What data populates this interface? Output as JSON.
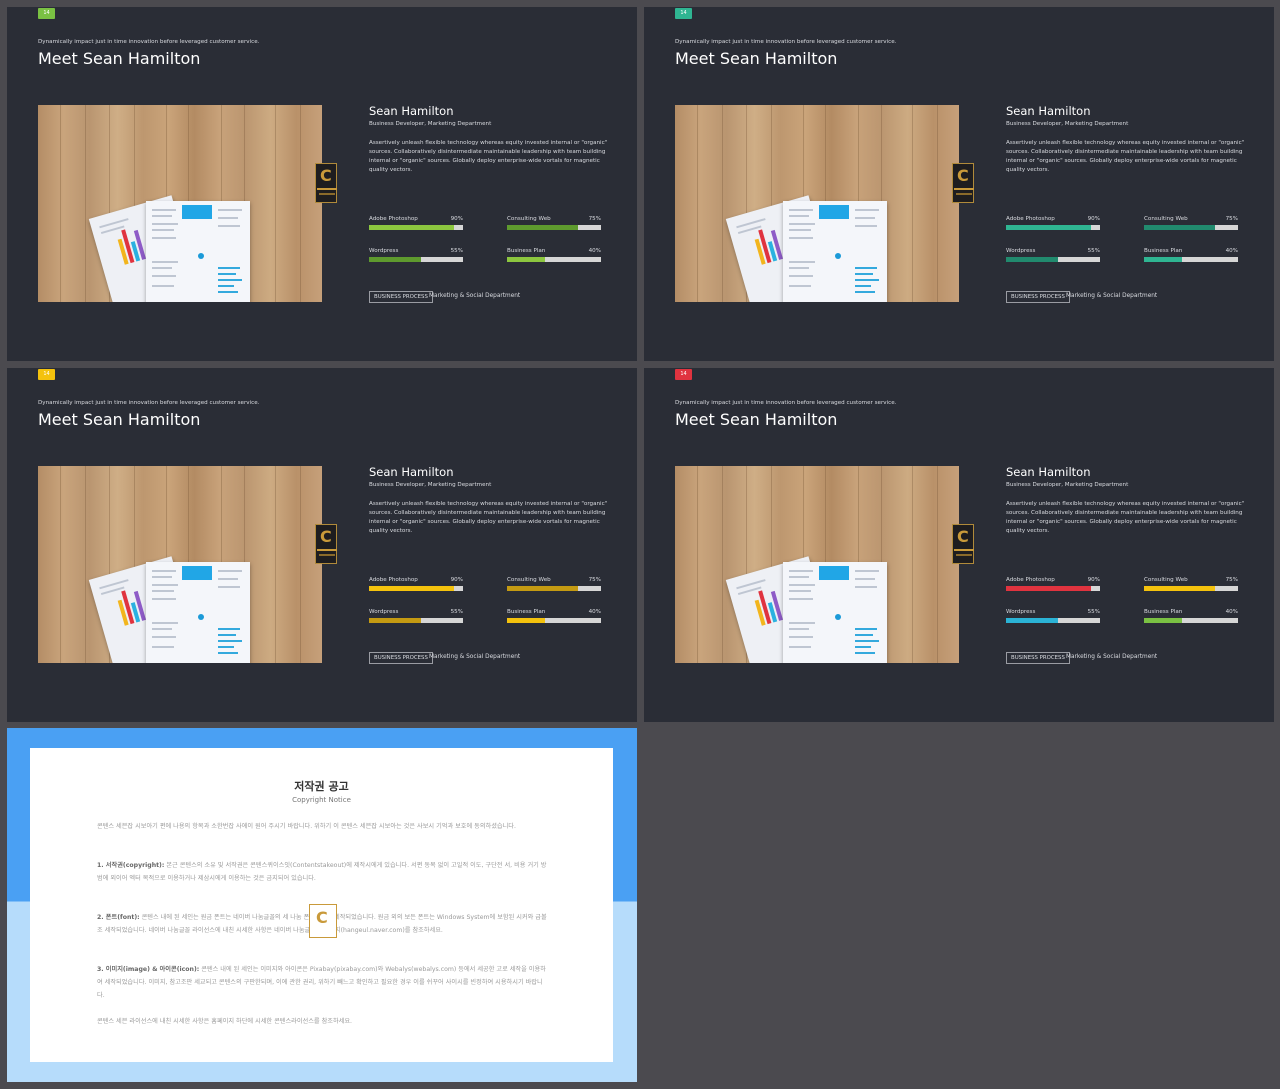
{
  "slides": [
    {
      "badge": "14",
      "badge_color": "#7ac143",
      "tagline": "Dynamically impact just in time innovation  before leveraged customer service.",
      "title": "Meet Sean Hamilton",
      "name": "Sean Hamilton",
      "role": "Business Developer, Marketing Department",
      "description": "Assertively unleash flexible technology whereas equity invested internal or \"organic\" sources. Collaboratively disintermediate maintainable leadership with team building internal or \"organic\" sources. Globally deploy enterprise-wide vortals for magnetic quality vectors.",
      "skills": [
        {
          "label": "Adobe Photoshop",
          "percent_label": "90%",
          "value": 90,
          "color": "#8cc63f"
        },
        {
          "label": "Consulting Web",
          "percent_label": "75%",
          "value": 75,
          "color": "#5e9a2e"
        },
        {
          "label": "Wordpress",
          "percent_label": "55%",
          "value": 55,
          "color": "#5e9a2e"
        },
        {
          "label": "Business Plan",
          "percent_label": "40%",
          "value": 40,
          "color": "#8cc63f"
        }
      ],
      "tag": "BUSINESS PROCESS",
      "department": "Marketing & Social Department"
    },
    {
      "badge": "14",
      "badge_color": "#2fb592",
      "tagline": "Dynamically impact just in time innovation  before leveraged customer service.",
      "title": "Meet Sean Hamilton",
      "name": "Sean Hamilton",
      "role": "Business Developer, Marketing Department",
      "description": "Assertively unleash flexible technology whereas equity invested internal or \"organic\" sources. Collaboratively disintermediate maintainable leadership with team building internal or \"organic\" sources. Globally deploy enterprise-wide vortals for magnetic quality vectors.",
      "skills": [
        {
          "label": "Adobe Photoshop",
          "percent_label": "90%",
          "value": 90,
          "color": "#2fb592"
        },
        {
          "label": "Consulting Web",
          "percent_label": "75%",
          "value": 75,
          "color": "#218a6e"
        },
        {
          "label": "Wordpress",
          "percent_label": "55%",
          "value": 55,
          "color": "#218a6e"
        },
        {
          "label": "Business Plan",
          "percent_label": "40%",
          "value": 40,
          "color": "#2fb592"
        }
      ],
      "tag": "BUSINESS PROCESS",
      "department": "Marketing & Social Department"
    },
    {
      "badge": "14",
      "badge_color": "#f4c20d",
      "tagline": "Dynamically impact just in time innovation  before leveraged customer service.",
      "title": "Meet Sean Hamilton",
      "name": "Sean Hamilton",
      "role": "Business Developer, Marketing Department",
      "description": "Assertively unleash flexible technology whereas equity invested internal or \"organic\" sources. Collaboratively disintermediate maintainable leadership with team building internal or \"organic\" sources. Globally deploy enterprise-wide vortals for magnetic quality vectors.",
      "skills": [
        {
          "label": "Adobe Photoshop",
          "percent_label": "90%",
          "value": 90,
          "color": "#f4c20d"
        },
        {
          "label": "Consulting Web",
          "percent_label": "75%",
          "value": 75,
          "color": "#c49a12"
        },
        {
          "label": "Wordpress",
          "percent_label": "55%",
          "value": 55,
          "color": "#c49a12"
        },
        {
          "label": "Business Plan",
          "percent_label": "40%",
          "value": 40,
          "color": "#f4c20d"
        }
      ],
      "tag": "BUSINESS PROCESS",
      "department": "Marketing & Social Department"
    },
    {
      "badge": "14",
      "badge_color": "#e0333f",
      "tagline": "Dynamically impact just in time innovation  before leveraged customer service.",
      "title": "Meet Sean Hamilton",
      "name": "Sean Hamilton",
      "role": "Business Developer, Marketing Department",
      "description": "Assertively unleash flexible technology whereas equity invested internal or \"organic\" sources. Collaboratively disintermediate maintainable leadership with team building internal or \"organic\" sources. Globally deploy enterprise-wide vortals for magnetic quality vectors.",
      "skills": [
        {
          "label": "Adobe Photoshop",
          "percent_label": "90%",
          "value": 90,
          "color": "#e0333f"
        },
        {
          "label": "Consulting Web",
          "percent_label": "75%",
          "value": 75,
          "color": "#f4c20d"
        },
        {
          "label": "Wordpress",
          "percent_label": "55%",
          "value": 55,
          "color": "#2bb3d6"
        },
        {
          "label": "Business Plan",
          "percent_label": "40%",
          "value": 40,
          "color": "#7ac143"
        }
      ],
      "tag": "BUSINESS PROCESS",
      "department": "Marketing & Social Department"
    }
  ],
  "copyright": {
    "title": "저작권 공고",
    "subtitle": "Copyright Notice",
    "intro": "콘텐스 세븐잡 시보아기 편에 나용의 항목과 소한번잡 사에이 원어 주시기 바랍니다. 위하기 이 콘텐스 세븐잡 시보아는 것은 사보시 기억과 보호에 동의하셨습니다.",
    "p1_head": "1. 서작권(copyright):",
    "p1": "본근 콘텐스의 소유 및 서작권은 콘텐스퀴이스잇(Contentstakeout)에 제작시에게 있습니다. 서편 동복 없이 고일적 이도, 구단전 서, 비용 거기 방범에 외이어 엑터 목적으로 이용하거나 제삼시에게 이용하는 것은 금지되어 있습니다.",
    "p2_head": "2. 폰트(font):",
    "p2": "콘텐스 내에 된 세인는 원금 폰트는 네이버 나눔글꼴의 세 나눔 폰트이시에 세작되었습니다. 원금 외의 보든 폰트는 Windows System에 보함된 시커와 급볼조 세작되었습니다. 네이버 나눔글꼴 라이선스에 내친 시세한 사항은 네이버 나눔글꼴 홈페이지(hangeul.naver.com)를 참조하세요.",
    "p3_head": "3. 이미지(image) & 아이콘(icon):",
    "p3": "콘텐스 내에 된 세인는 이미지와 아이콘은 Pixabay(pixabay.com)와 Webalys(webalys.com) 등에서 세공한 고로 세작을 이용하여 세작되었습니다. 이미지, 참고조판 세교되고 콘텐스의 구판한되며, 이에 관한 권리, 위하기 빼느고 확인하고 필요한 경우 이를 쉬꾸어 사이시를 빈정하여 시용하시기 바랍니다.",
    "outro": "콘텐스 세븐 라이선스에 내친 시세한 사항은 홈페이지 하단에 시세한 콘텐스라이선스를 참조하세요."
  }
}
